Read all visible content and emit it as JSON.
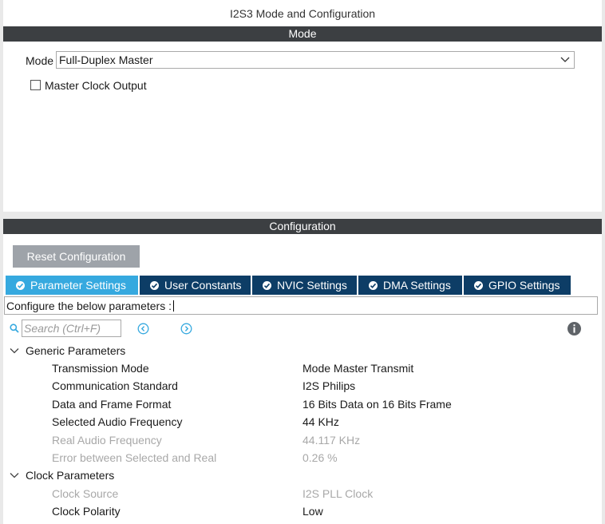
{
  "window": {
    "title": "I2S3 Mode and Configuration"
  },
  "mode_section": {
    "header": "Mode",
    "mode_label": "Mode",
    "mode_value": "Full-Duplex Master",
    "master_clock_output": {
      "label": "Master Clock Output",
      "checked": false
    }
  },
  "config_section": {
    "header": "Configuration",
    "reset_button": "Reset Configuration",
    "tabs": [
      {
        "label": "Parameter Settings",
        "active": true
      },
      {
        "label": "User Constants",
        "active": false
      },
      {
        "label": "NVIC Settings",
        "active": false
      },
      {
        "label": "DMA Settings",
        "active": false
      },
      {
        "label": "GPIO Settings",
        "active": false
      }
    ],
    "info_text": "Configure the below parameters :",
    "search": {
      "placeholder": "Search (Ctrl+F)"
    },
    "groups": [
      {
        "label": "Generic Parameters",
        "params": [
          {
            "name": "Transmission Mode",
            "value": "Mode Master Transmit",
            "enabled": true
          },
          {
            "name": "Communication Standard",
            "value": "I2S Philips",
            "enabled": true
          },
          {
            "name": "Data and Frame Format",
            "value": "16 Bits Data on 16 Bits Frame",
            "enabled": true
          },
          {
            "name": "Selected Audio Frequency",
            "value": "44 KHz",
            "enabled": true
          },
          {
            "name": "Real Audio Frequency",
            "value": "44.117 KHz",
            "enabled": false
          },
          {
            "name": "Error between Selected and Real",
            "value": "0.26 %",
            "enabled": false
          }
        ]
      },
      {
        "label": "Clock Parameters",
        "params": [
          {
            "name": "Clock Source",
            "value": "I2S PLL Clock",
            "enabled": false
          },
          {
            "name": "Clock Polarity",
            "value": "Low",
            "enabled": true
          }
        ]
      }
    ]
  },
  "colors": {
    "header_bg": "#3c3f42",
    "tab_active": "#36a9df",
    "tab_inactive": "#0d3d66",
    "reset_button_bg": "#9ea3a9",
    "disabled_text": "#a8a8a8",
    "accent_icon": "#36a9df"
  },
  "icons": [
    "chevron-down-icon",
    "checkmark-circle-icon",
    "search-icon",
    "previous-icon",
    "next-icon",
    "info-icon"
  ]
}
